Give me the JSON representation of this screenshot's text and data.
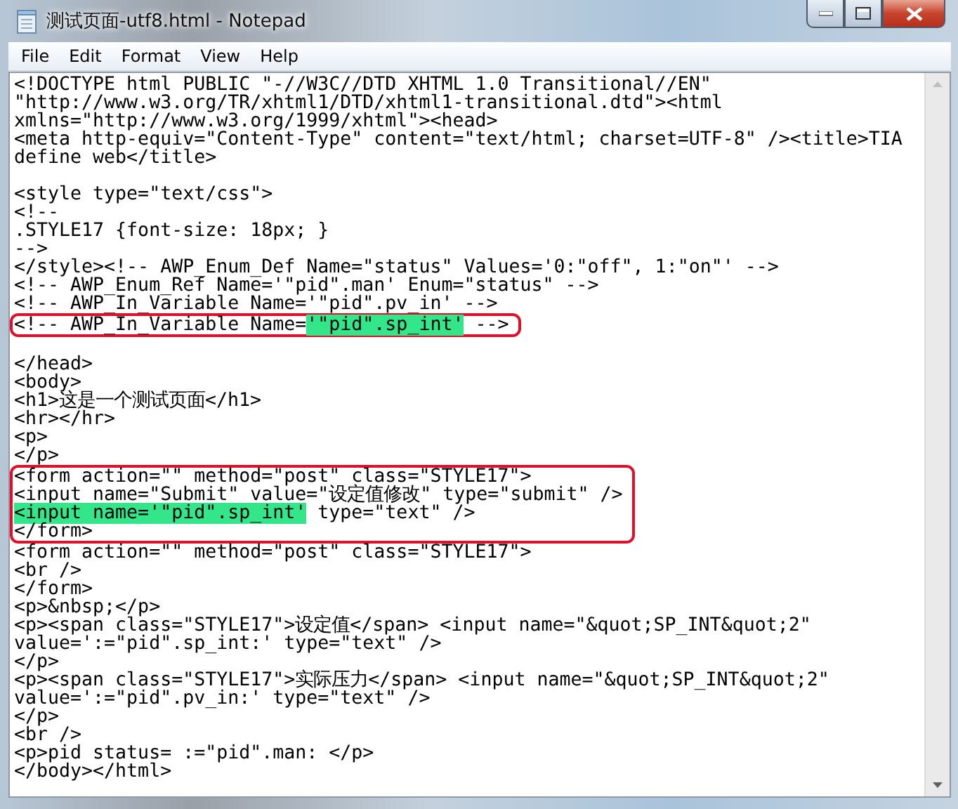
{
  "window": {
    "title": "测试页面-utf8.html - Notepad"
  },
  "menu": [
    "File",
    "Edit",
    "Format",
    "View",
    "Help"
  ],
  "blocks": [
    {
      "boxed": false,
      "lines": [
        {
          "kind": "code",
          "segments": [
            {
              "text": "<!DOCTYPE html PUBLIC \"-//W3C//DTD XHTML 1.0 Transitional//EN\"",
              "highlighted": false
            }
          ]
        },
        {
          "kind": "code",
          "segments": [
            {
              "text": "\"http://www.w3.org/TR/xhtml1/DTD/xhtml1-transitional.dtd\"><html",
              "highlighted": false
            }
          ]
        },
        {
          "kind": "code",
          "segments": [
            {
              "text": "xmlns=\"http://www.w3.org/1999/xhtml\"><head>",
              "highlighted": false
            }
          ]
        },
        {
          "kind": "code",
          "segments": [
            {
              "text": "<meta http-equiv=\"Content-Type\" content=\"text/html; charset=UTF-8\" /><title>TIA",
              "highlighted": false
            }
          ]
        },
        {
          "kind": "code",
          "segments": [
            {
              "text": "define web</title>",
              "highlighted": false
            }
          ]
        },
        {
          "kind": "blank"
        },
        {
          "kind": "code",
          "segments": [
            {
              "text": "<style type=\"text/css\">",
              "highlighted": false
            }
          ]
        },
        {
          "kind": "code",
          "segments": [
            {
              "text": "<!--",
              "highlighted": false
            }
          ]
        },
        {
          "kind": "code",
          "segments": [
            {
              "text": ".STYLE17 {font-size: 18px; }",
              "highlighted": false
            }
          ]
        },
        {
          "kind": "code",
          "segments": [
            {
              "text": "-->",
              "highlighted": false
            }
          ]
        },
        {
          "kind": "code",
          "segments": [
            {
              "text": "</style><!-- AWP_Enum_Def Name=\"status\" Values='0:\"off\", 1:\"on\"' -->",
              "highlighted": false
            }
          ]
        },
        {
          "kind": "code",
          "segments": [
            {
              "text": "<!-- AWP_Enum_Ref Name='\"pid\".man' Enum=\"status\" -->",
              "highlighted": false
            }
          ]
        },
        {
          "kind": "code",
          "segments": [
            {
              "text": "<!-- AWP_In_Variable Name='\"pid\".pv_in' -->",
              "highlighted": false
            }
          ]
        }
      ]
    },
    {
      "boxed": true,
      "lines": [
        {
          "kind": "code",
          "segments": [
            {
              "text": "<!-- AWP_In_Variable Name=",
              "highlighted": false
            },
            {
              "text": "'\"pid\".sp_int'",
              "highlighted": true
            },
            {
              "text": " -->",
              "highlighted": false
            }
          ]
        }
      ]
    },
    {
      "boxed": false,
      "lines": [
        {
          "kind": "blank"
        },
        {
          "kind": "code",
          "segments": [
            {
              "text": "</head>",
              "highlighted": false
            }
          ]
        },
        {
          "kind": "code",
          "segments": [
            {
              "text": "<body>",
              "highlighted": false
            }
          ]
        },
        {
          "kind": "code",
          "segments": [
            {
              "text": "<h1>这是一个测试页面</h1>",
              "highlighted": false
            }
          ]
        },
        {
          "kind": "code",
          "segments": [
            {
              "text": "<hr></hr>",
              "highlighted": false
            }
          ]
        },
        {
          "kind": "code",
          "segments": [
            {
              "text": "<p>",
              "highlighted": false
            }
          ]
        },
        {
          "kind": "code",
          "segments": [
            {
              "text": "</p>",
              "highlighted": false
            }
          ]
        }
      ]
    },
    {
      "boxed": true,
      "lines": [
        {
          "kind": "code",
          "segments": [
            {
              "text": "<form action=\"\" method=\"post\" class=\"STYLE17\">",
              "highlighted": false
            }
          ]
        },
        {
          "kind": "code",
          "segments": [
            {
              "text": "<input name=\"Submit\" value=\"设定值修改\" type=\"submit\" />",
              "highlighted": false
            }
          ]
        },
        {
          "kind": "code",
          "segments": [
            {
              "text": "<input name='\"pid\".sp_int'",
              "highlighted": true
            },
            {
              "text": " type=\"text\" />",
              "highlighted": false
            }
          ]
        },
        {
          "kind": "code",
          "segments": [
            {
              "text": "</form>",
              "highlighted": false
            }
          ]
        }
      ]
    },
    {
      "boxed": false,
      "lines": [
        {
          "kind": "code",
          "segments": [
            {
              "text": "<form action=\"\" method=\"post\" class=\"STYLE17\">",
              "highlighted": false
            }
          ]
        },
        {
          "kind": "code",
          "segments": [
            {
              "text": "<br />",
              "highlighted": false
            }
          ]
        },
        {
          "kind": "code",
          "segments": [
            {
              "text": "</form>",
              "highlighted": false
            }
          ]
        },
        {
          "kind": "code",
          "segments": [
            {
              "text": "<p>&nbsp;</p>",
              "highlighted": false
            }
          ]
        },
        {
          "kind": "code",
          "segments": [
            {
              "text": "<p><span class=\"STYLE17\">设定值</span> <input name=\"&quot;SP_INT&quot;2\"",
              "highlighted": false
            }
          ]
        },
        {
          "kind": "code",
          "segments": [
            {
              "text": "value=':=\"pid\".sp_int:' type=\"text\" />",
              "highlighted": false
            }
          ]
        },
        {
          "kind": "code",
          "segments": [
            {
              "text": "</p>",
              "highlighted": false
            }
          ]
        },
        {
          "kind": "code",
          "segments": [
            {
              "text": "<p><span class=\"STYLE17\">实际压力</span> <input name=\"&quot;SP_INT&quot;2\"",
              "highlighted": false
            }
          ]
        },
        {
          "kind": "code",
          "segments": [
            {
              "text": "value=':=\"pid\".pv_in:' type=\"text\" />",
              "highlighted": false
            }
          ]
        },
        {
          "kind": "code",
          "segments": [
            {
              "text": "</p>",
              "highlighted": false
            }
          ]
        },
        {
          "kind": "code",
          "segments": [
            {
              "text": "<br />",
              "highlighted": false
            }
          ]
        },
        {
          "kind": "code",
          "segments": [
            {
              "text": "<p>pid status= :=\"pid\".man: </p>",
              "highlighted": false
            }
          ]
        },
        {
          "kind": "code",
          "segments": [
            {
              "text": "</body></html>",
              "highlighted": false
            }
          ]
        }
      ]
    }
  ]
}
